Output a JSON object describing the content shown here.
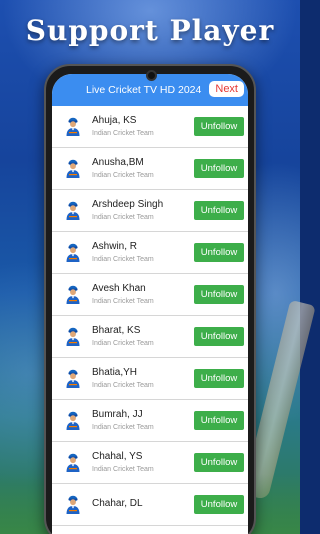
{
  "headline": "Support Player",
  "app": {
    "title": "Live Cricket TV HD 2024",
    "next_label": "Next"
  },
  "players": [
    {
      "name": "Ahuja, KS",
      "team": "Indian Cricket Team",
      "action": "Unfollow"
    },
    {
      "name": "Anusha,BM",
      "team": "Indian Cricket Team",
      "action": "Unfollow"
    },
    {
      "name": "Arshdeep Singh",
      "team": "Indian Cricket Team",
      "action": "Unfollow"
    },
    {
      "name": "Ashwin, R",
      "team": "Indian Cricket Team",
      "action": "Unfollow"
    },
    {
      "name": "Avesh Khan",
      "team": "Indian Cricket Team",
      "action": "Unfollow"
    },
    {
      "name": "Bharat, KS",
      "team": "Indian Cricket Team",
      "action": "Unfollow"
    },
    {
      "name": "Bhatia,YH",
      "team": "Indian Cricket Team",
      "action": "Unfollow"
    },
    {
      "name": "Bumrah, JJ",
      "team": "Indian Cricket Team",
      "action": "Unfollow"
    },
    {
      "name": "Chahal, YS",
      "team": "Indian Cricket Team",
      "action": "Unfollow"
    },
    {
      "name": "Chahar, DL",
      "team": "",
      "action": "Unfollow"
    }
  ],
  "colors": {
    "appbar": "#3b8df0",
    "unfollow": "#3dae4a",
    "next_text": "#e53935"
  },
  "icons": {
    "player": "cricketer-avatar-icon"
  }
}
